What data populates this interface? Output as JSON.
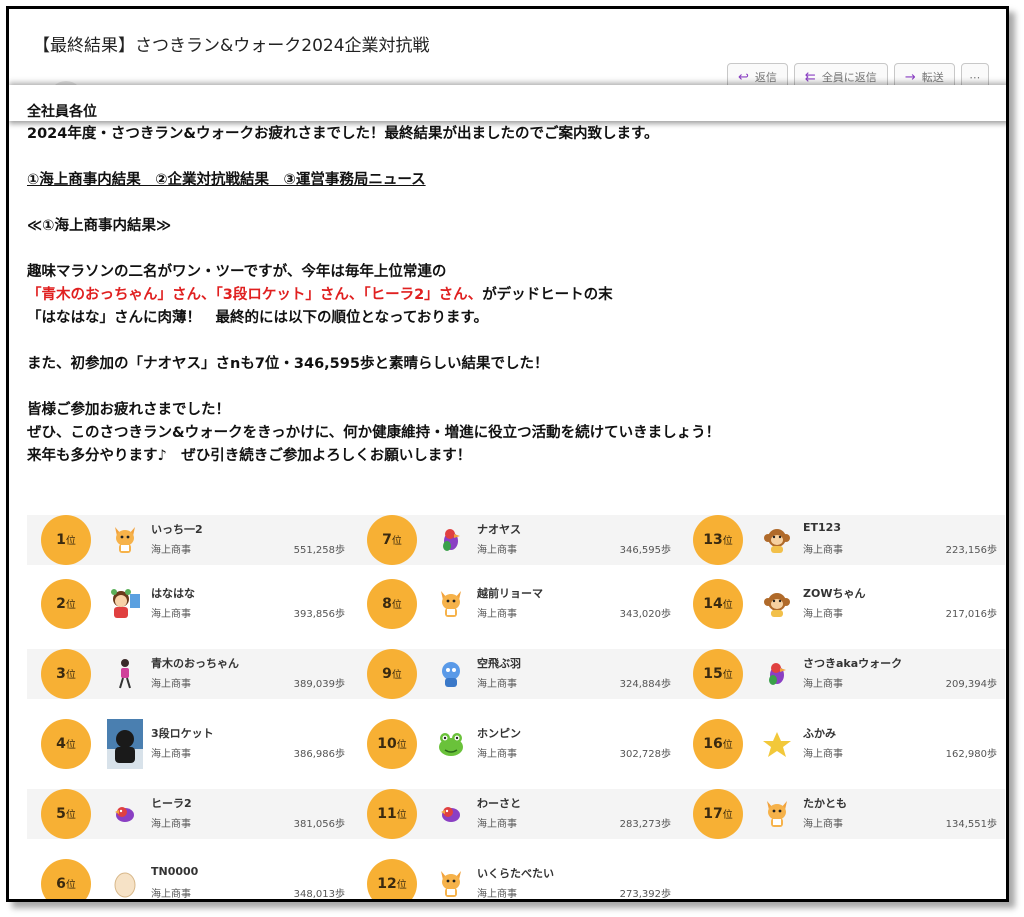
{
  "email": {
    "subject": "【最終結果】さつきラン&ウォーク2024企業対抗戦",
    "toolbar": {
      "reply": "返信",
      "reply_all": "全員に返信",
      "forward": "転送",
      "more": "⋯"
    },
    "recipient": "全社員各位",
    "body_lines": [
      "2024年度・さつきラン&ウォークお疲れさまでした！最終結果が出ましたのでご案内致します。",
      "",
      "①海上商事内結果　②企業対抗戦結果　③運営事務局ニュース",
      "",
      "≪①海上商事内結果≫",
      "",
      "趣味マラソンの二名がワン・ツーですが、今年は毎年上位常連の",
      "",
      "「はなはな」さんに肉薄！　最終的には以下の順位となっております。",
      "",
      "また、初参加の「ナオヤス」さnも7位・346,595歩と素晴らしい結果でした！",
      "",
      "皆様ご参加お疲れさまでした！",
      "ぜひ、このさつきラン&ウォークをきっかけに、何か健康維持・増進に役立つ活動を続けていきましょう！",
      "来年も多分やります♪　ぜひ引き続きご参加よろしくお願いします！"
    ],
    "red_line": {
      "red": "「青木のおっちゃん」さん、「3段ロケット」さん、「ヒーラ2」さん、",
      "normal": "がデッドヒートの末"
    }
  },
  "rank_suffix": "位",
  "rankings": [
    {
      "rank": "1",
      "name": "いっち一2",
      "dept": "海上商事",
      "steps": "551,258歩",
      "icon": "fox-character-icon"
    },
    {
      "rank": "2",
      "name": "はなはな",
      "dept": "海上商事",
      "steps": "393,856歩",
      "icon": "girl-character-icon"
    },
    {
      "rank": "3",
      "name": "青木のおっちゃん",
      "dept": "海上商事",
      "steps": "389,039歩",
      "icon": "runner-character-icon"
    },
    {
      "rank": "4",
      "name": "3段ロケット",
      "dept": "海上商事",
      "steps": "386,986歩",
      "icon": "user-photo-icon"
    },
    {
      "rank": "5",
      "name": "ヒーラ2",
      "dept": "海上商事",
      "steps": "381,056歩",
      "icon": "bird-character-icon"
    },
    {
      "rank": "6",
      "name": "TN0000",
      "dept": "海上商事",
      "steps": "348,013歩",
      "icon": "egg-icon"
    },
    {
      "rank": "7",
      "name": "ナオヤス",
      "dept": "海上商事",
      "steps": "346,595歩",
      "icon": "parrot-character-icon"
    },
    {
      "rank": "8",
      "name": "越前リョーマ",
      "dept": "海上商事",
      "steps": "343,020歩",
      "icon": "fox-character-icon"
    },
    {
      "rank": "9",
      "name": "空飛ぶ羽",
      "dept": "海上商事",
      "steps": "324,884歩",
      "icon": "blue-character-icon"
    },
    {
      "rank": "10",
      "name": "ホンピン",
      "dept": "海上商事",
      "steps": "302,728歩",
      "icon": "frog-character-icon"
    },
    {
      "rank": "11",
      "name": "わーさと",
      "dept": "海上商事",
      "steps": "283,273歩",
      "icon": "bird-character-icon"
    },
    {
      "rank": "12",
      "name": "いくらたべたい",
      "dept": "海上商事",
      "steps": "273,392歩",
      "icon": "fox-character-icon"
    },
    {
      "rank": "13",
      "name": "ET123",
      "dept": "海上商事",
      "steps": "223,156歩",
      "icon": "monkey-character-icon"
    },
    {
      "rank": "14",
      "name": "ZOWちゃん",
      "dept": "海上商事",
      "steps": "217,016歩",
      "icon": "monkey-character-icon"
    },
    {
      "rank": "15",
      "name": "さつきakaウォーク",
      "dept": "海上商事",
      "steps": "209,394歩",
      "icon": "parrot-character-icon"
    },
    {
      "rank": "16",
      "name": "ふかみ",
      "dept": "海上商事",
      "steps": "162,980歩",
      "icon": "star-character-icon"
    },
    {
      "rank": "17",
      "name": "たかとも",
      "dept": "海上商事",
      "steps": "134,551歩",
      "icon": "fox-character-icon"
    }
  ]
}
